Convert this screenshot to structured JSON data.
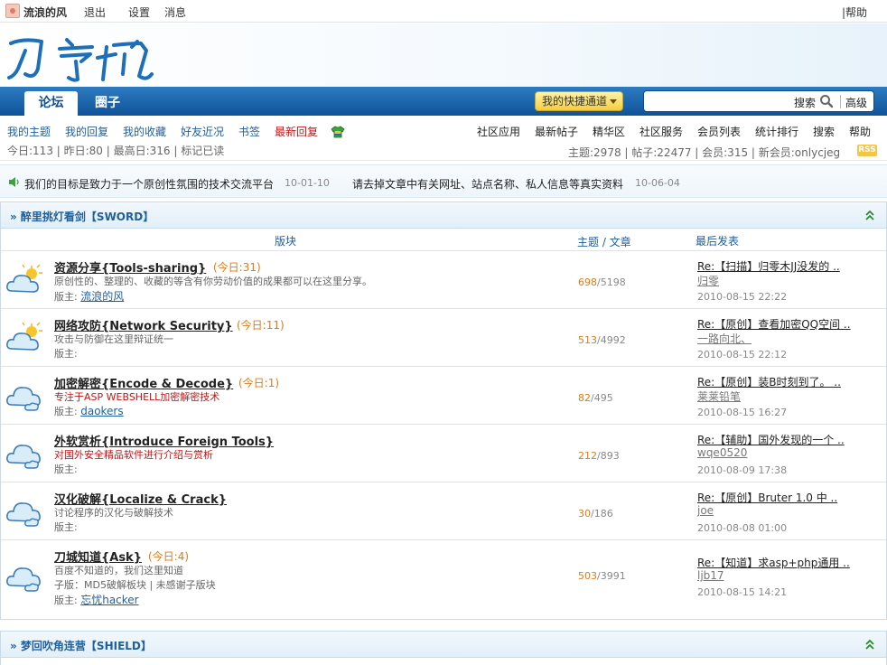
{
  "topbar": {
    "username": "流浪的风",
    "logout": "退出",
    "settings": "设置",
    "messages": "消息",
    "help": "|帮助"
  },
  "nav": {
    "tab_forum": "论坛",
    "tab_circle": "圈子",
    "quick_channel": "我的快捷通道",
    "search_label": "搜索",
    "search_value": "",
    "advanced": "高级"
  },
  "subnav": {
    "left": [
      "我的主题",
      "我的回复",
      "我的收藏",
      "好友近况",
      "书签",
      "最新回复"
    ],
    "right": [
      "社区应用",
      "最新帖子",
      "精华区",
      "社区服务",
      "会员列表",
      "统计排行",
      "搜索",
      "帮助"
    ],
    "stats_left": "今日:113 | 昨日:80 | 最高日:316 | 标记已读",
    "stats_right": "主题:2978 | 帖子:22477 | 会员:315 | 新会员:onlycjeg",
    "rss": "RSS"
  },
  "announcements": [
    {
      "text": "我们的目标是致力于一个原创性氛围的技术交流平台",
      "date": "10-01-10"
    },
    {
      "text": "请去掉文章中有关网址、站点名称、私人信息等真实资料",
      "date": "10-06-04"
    }
  ],
  "section1": {
    "title": "» 醉里挑灯看剑【SWORD】",
    "col_board": "版块",
    "col_counts": "主题 / 文章",
    "col_last": "最后发表",
    "forums": [
      {
        "name": "资源分享{Tools-sharing}",
        "today": "(今日:31)",
        "desc": "原创性的、整理的、收藏的等含有你劳动价值的成果都可以在这里分享。",
        "mod_label": "版主:",
        "mod": "流浪的风",
        "topics": "698",
        "posts": "/5198",
        "last_title": "Re:【扫描】归零木JJ没发的 ..",
        "last_user": "归零",
        "last_time": "2010-08-15 22:22"
      },
      {
        "name": "网络攻防{Network Security}",
        "today": "(今日:11)",
        "desc": "攻击与防御在这里辩证统一",
        "mod_label": "版主:",
        "mod": "",
        "topics": "513",
        "posts": "/4992",
        "last_title": "Re:【原创】查看加密QQ空间 ..",
        "last_user": "一路向北、",
        "last_time": "2010-08-15 22:12"
      },
      {
        "name": "加密解密{Encode & Decode}",
        "today": "(今日:1)",
        "desc": "专注于ASP WEBSHELL加密解密技术",
        "mod_label": "版主:",
        "mod": "daokers",
        "topics": "82",
        "posts": "/495",
        "last_title": "Re:【原创】装B时刻到了。 ..",
        "last_user": "莱莱铅笔",
        "last_time": "2010-08-15 16:27"
      },
      {
        "name": "外软赏析{Introduce Foreign Tools}",
        "today": "",
        "desc": "对国外安全精品软件进行介绍与赏析",
        "mod_label": "版主:",
        "mod": "",
        "topics": "212",
        "posts": "/893",
        "last_title": "Re:【辅助】国外发现的一个 ..",
        "last_user": "wqe0520",
        "last_time": "2010-08-09 17:38"
      },
      {
        "name": "汉化破解{Localize & Crack}",
        "today": "",
        "desc": "讨论程序的汉化与破解技术",
        "mod_label": "版主:",
        "mod": "",
        "topics": "30",
        "posts": "/186",
        "last_title": "Re:【原创】Bruter 1.0 中 ..",
        "last_user": "joe",
        "last_time": "2010-08-08 01:00"
      },
      {
        "name": "刀城知道{Ask}",
        "today": "(今日:4)",
        "desc": "百度不知道的，我们这里知道",
        "extra": "子版：MD5破解板块 | 未感谢子版块",
        "mod_label": "版主:",
        "mod": "忘忧hacker",
        "topics": "503",
        "posts": "/3991",
        "last_title": "Re:【知道】求asp+php通用 ..",
        "last_user": "ljb17",
        "last_time": "2010-08-15 14:21"
      }
    ]
  },
  "section2": {
    "title": "» 梦回吹角连营【SHIELD】"
  }
}
